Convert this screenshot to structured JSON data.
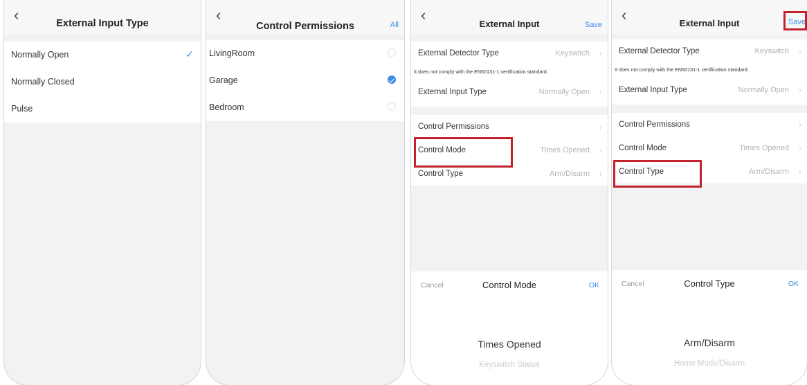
{
  "screen1": {
    "title": "External Input Type",
    "options": [
      {
        "label": "Normally Open",
        "selected": true
      },
      {
        "label": "Normally Closed",
        "selected": false
      },
      {
        "label": "Pulse",
        "selected": false
      }
    ],
    "check_glyph": "✓"
  },
  "screen2": {
    "title": "Control Permissions",
    "right_action": "All",
    "rooms": [
      {
        "label": "LivingRoom",
        "checked": false
      },
      {
        "label": "Garage",
        "checked": true
      },
      {
        "label": "Bedroom",
        "checked": false
      }
    ]
  },
  "screen3": {
    "title": "External Input",
    "right_action": "Save",
    "detector_label": "External Detector Type",
    "detector_value": "Keyswitch",
    "warning": "It does not comply with the EN50131-1 certification standard.",
    "input_type_label": "External Input Type",
    "input_type_value": "Normally Open",
    "permissions_label": "Control Permissions",
    "mode_label": "Control Mode",
    "mode_value": "Times Opened",
    "ctype_label": "Control Type",
    "ctype_value": "Arm/Disarm",
    "picker": {
      "cancel": "Cancel",
      "title": "Control Mode",
      "ok": "OK",
      "option_selected": "Times Opened",
      "option_other": "Keyswitch Status"
    }
  },
  "screen4": {
    "title": "External Input",
    "right_action": "Save",
    "detector_label": "External Detector Type",
    "detector_value": "Keyswitch",
    "warning": "It does not comply with the EN50131-1 certification standard.",
    "input_type_label": "External Input Type",
    "input_type_value": "Normally Open",
    "permissions_label": "Control Permissions",
    "mode_label": "Control Mode",
    "mode_value": "Times Opened",
    "ctype_label": "Control Type",
    "ctype_value": "Arm/Disarm",
    "picker": {
      "cancel": "Cancel",
      "title": "Control Type",
      "ok": "OK",
      "option_selected": "Arm/Disarm",
      "option_other": "Home Mode/Disarm"
    }
  },
  "icons": {
    "back": "‹",
    "chevron": "›"
  },
  "colors": {
    "accent": "#3a8ee6",
    "highlight": "#c3212e",
    "background": "#f2f2f4"
  }
}
